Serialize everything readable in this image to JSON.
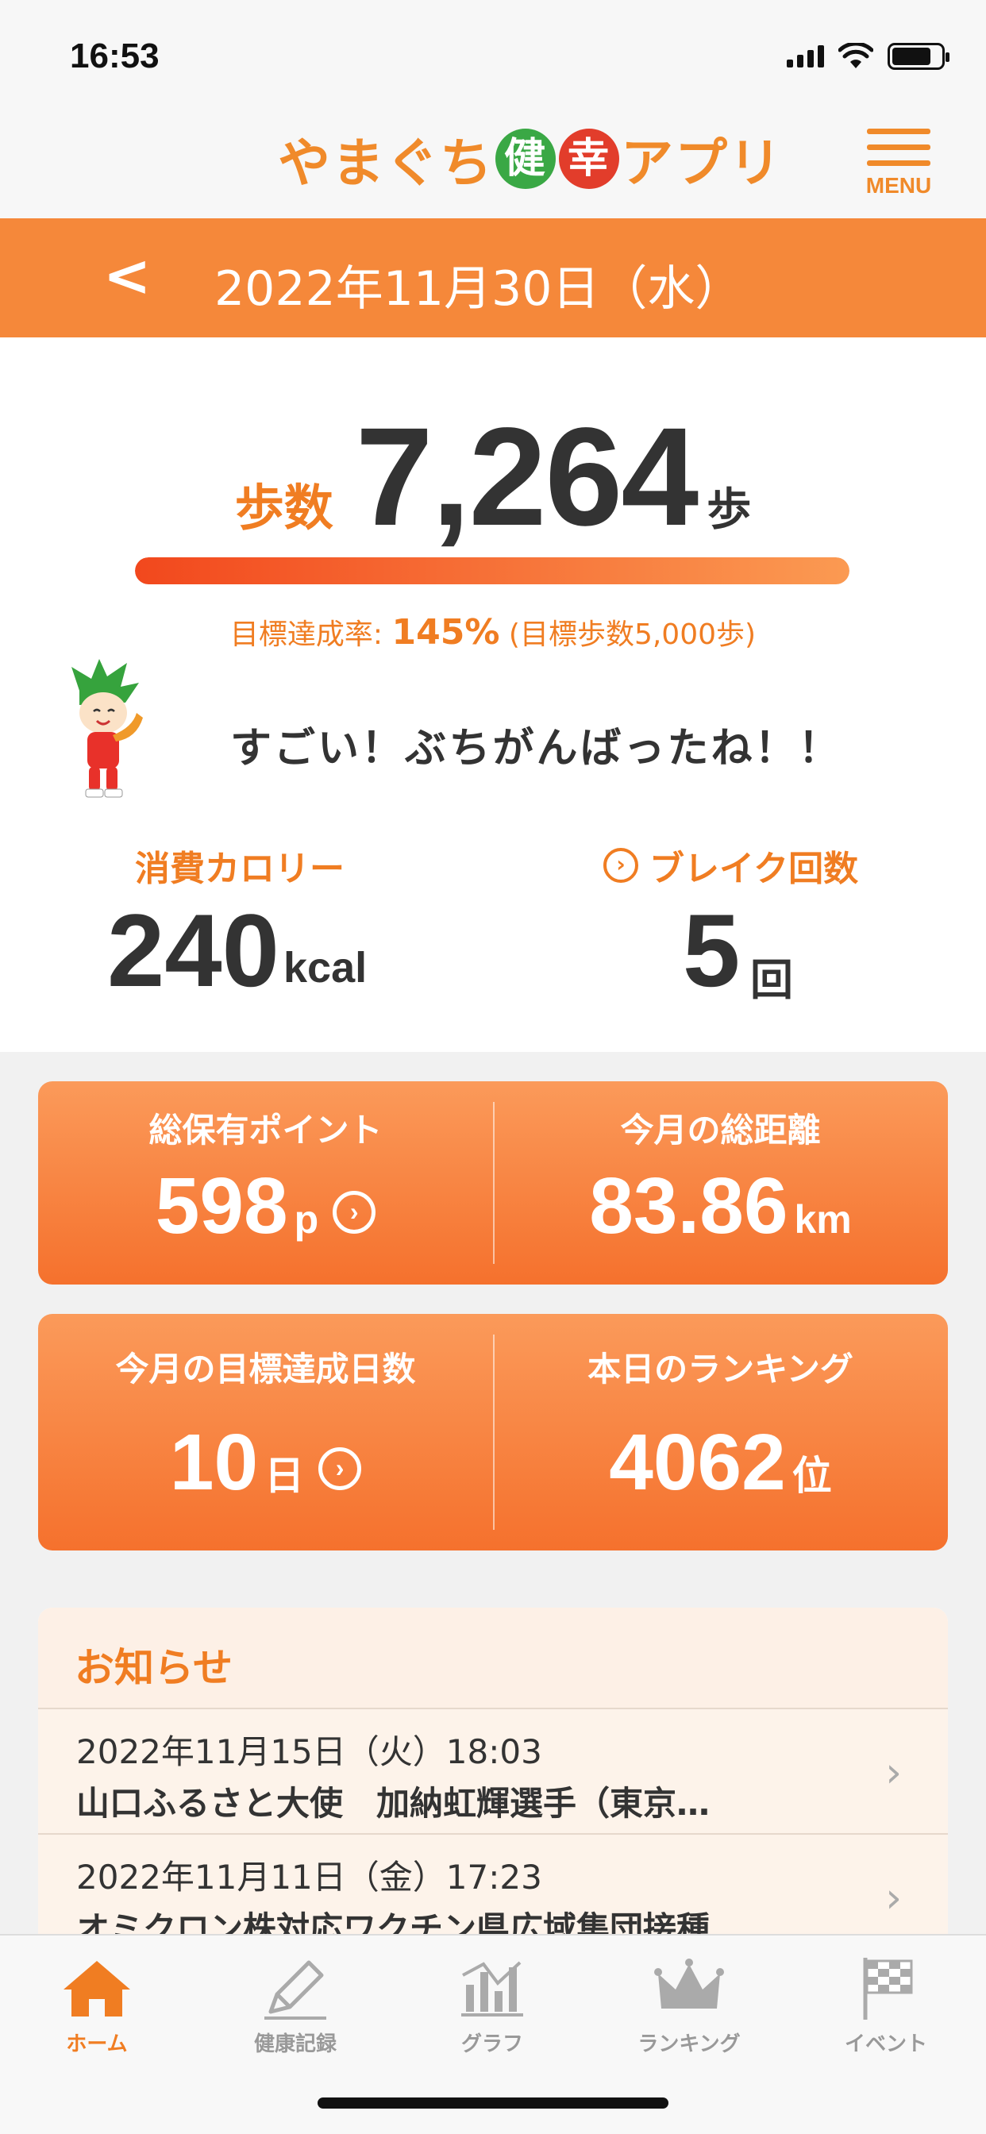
{
  "status_bar": {
    "time": "16:53"
  },
  "header": {
    "logo_pre": "やまぐち",
    "logo_kanji1": "健",
    "logo_kanji2": "幸",
    "logo_post": "アプリ",
    "menu_label": "MENU",
    "accent_color": "#f5883a"
  },
  "date_bar": {
    "back_symbol": "<",
    "date": "2022年11月30日（水）"
  },
  "steps": {
    "label": "歩数",
    "value": "7,264",
    "unit": "歩",
    "progress_fraction": 1.0,
    "goal_prefix": "目標達成率:",
    "goal_rate": "145%",
    "goal_note": "(目標歩数5,000歩)"
  },
  "message": "すごい！ぶちがんばったね！！",
  "calories": {
    "label": "消費カロリー",
    "value": "240",
    "unit": "kcal"
  },
  "breaks": {
    "label": "ブレイク回数",
    "value": "5",
    "unit": "回"
  },
  "cards": {
    "points": {
      "label": "総保有ポイント",
      "value": "598",
      "unit": "p"
    },
    "distance": {
      "label": "今月の総距離",
      "value": "83.86",
      "unit": "km"
    },
    "goal_days": {
      "label": "今月の目標達成日数",
      "value": "10",
      "unit": "日"
    },
    "ranking": {
      "label": "本日のランキング",
      "value": "4062",
      "unit": "位"
    }
  },
  "news": {
    "title": "お知らせ",
    "items": [
      {
        "date": "2022年11月15日（火）18:03",
        "title": "山口ふるさと大使　加納虹輝選手（東京…"
      },
      {
        "date": "2022年11月11日（金）17:23",
        "title": "オミクロン株対応ワクチン県広域集団接種…"
      }
    ]
  },
  "tabs": [
    {
      "label": "ホーム",
      "icon": "home-icon",
      "active": true
    },
    {
      "label": "健康記録",
      "icon": "pencil-icon",
      "active": false
    },
    {
      "label": "グラフ",
      "icon": "chart-icon",
      "active": false
    },
    {
      "label": "ランキング",
      "icon": "crown-icon",
      "active": false
    },
    {
      "label": "イベント",
      "icon": "flag-icon",
      "active": false
    }
  ]
}
